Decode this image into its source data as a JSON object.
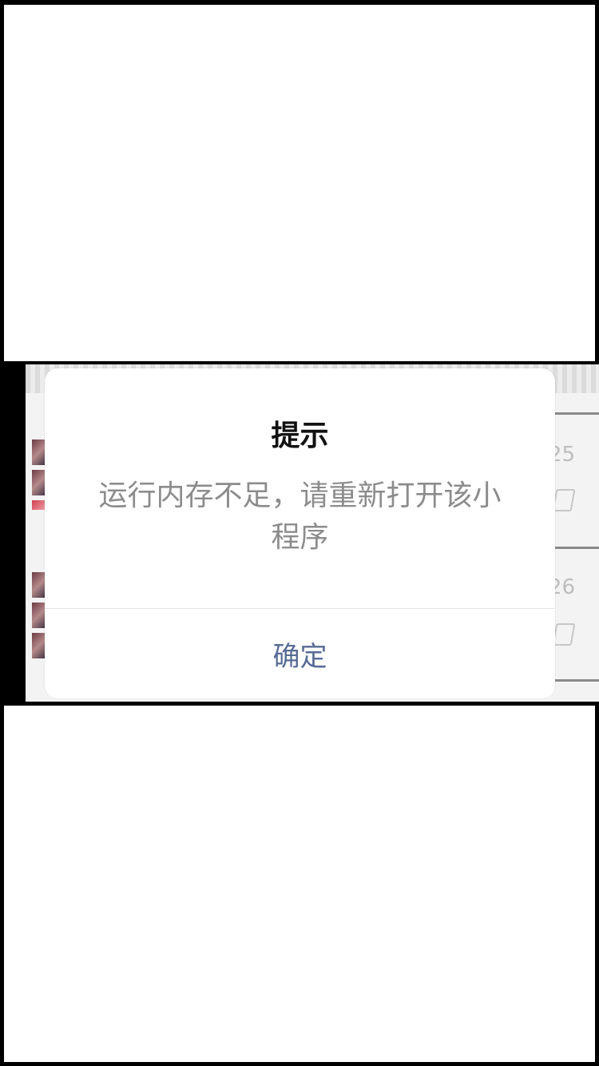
{
  "dialog": {
    "title": "提示",
    "message": "运行内存不足，请重新打开该小程序",
    "confirm_label": "确定"
  },
  "background": {
    "numbers": [
      "25",
      "26"
    ]
  },
  "colors": {
    "dialog_background": "#ffffff",
    "title": "#111111",
    "message": "#8c8c8c",
    "confirm": "#576b95",
    "frame": "#000000"
  }
}
